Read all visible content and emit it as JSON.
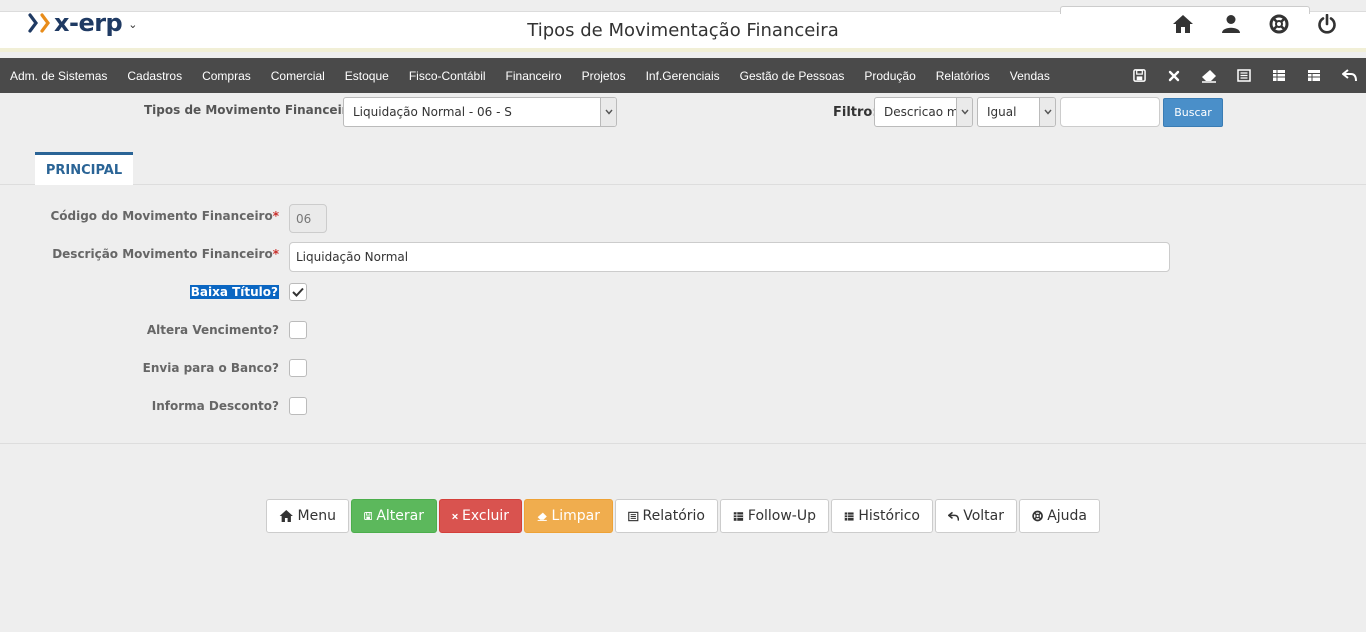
{
  "header": {
    "logo_text": "x-erp",
    "title": "Tipos de Movimentação Financeira",
    "icons": [
      "home-icon",
      "user-icon",
      "lifebuoy-icon",
      "power-icon"
    ]
  },
  "menu": {
    "items": [
      "Adm. de Sistemas",
      "Cadastros",
      "Compras",
      "Comercial",
      "Estoque",
      "Fisco-Contábil",
      "Financeiro",
      "Projetos",
      "Inf.Gerenciais",
      "Gestão de Pessoas",
      "Produção",
      "Relatórios",
      "Vendas"
    ],
    "tools": [
      "save-icon",
      "close-icon",
      "eraser-icon",
      "list-icon",
      "table-icon",
      "table-alt-icon",
      "undo-icon"
    ]
  },
  "selector": {
    "label": "Tipos de Movimento Financeiro",
    "value": "Liquidação Normal - 06 - S"
  },
  "filter": {
    "label": "Filtro:",
    "field": "Descricao mo",
    "operator": "Igual",
    "value": "",
    "search_label": "Buscar"
  },
  "tabs": [
    "PRINCIPAL"
  ],
  "form": {
    "codigo_label": "Código do Movimento Financeiro",
    "codigo_value": "06",
    "descricao_label": "Descrição Movimento Financeiro",
    "descricao_value": "Liquidação Normal",
    "required_mark": "*",
    "checkboxes": [
      {
        "label": "Baixa Título?",
        "checked": true
      },
      {
        "label": "Altera Vencimento?",
        "checked": false
      },
      {
        "label": "Envia para o Banco?",
        "checked": false
      },
      {
        "label": "Informa Desconto?",
        "checked": false
      }
    ]
  },
  "actions": [
    "Menu",
    "Alterar",
    "Excluir",
    "Limpar",
    "Relatório",
    "Follow-Up",
    "Histórico",
    "Voltar",
    "Ajuda"
  ],
  "colors": {
    "menubar": "#4a4a4a",
    "tab_accent": "#2a6496",
    "success": "#5cb85c",
    "danger": "#d9534f",
    "warning": "#f0ad4e",
    "info": "#4a8fc9"
  }
}
